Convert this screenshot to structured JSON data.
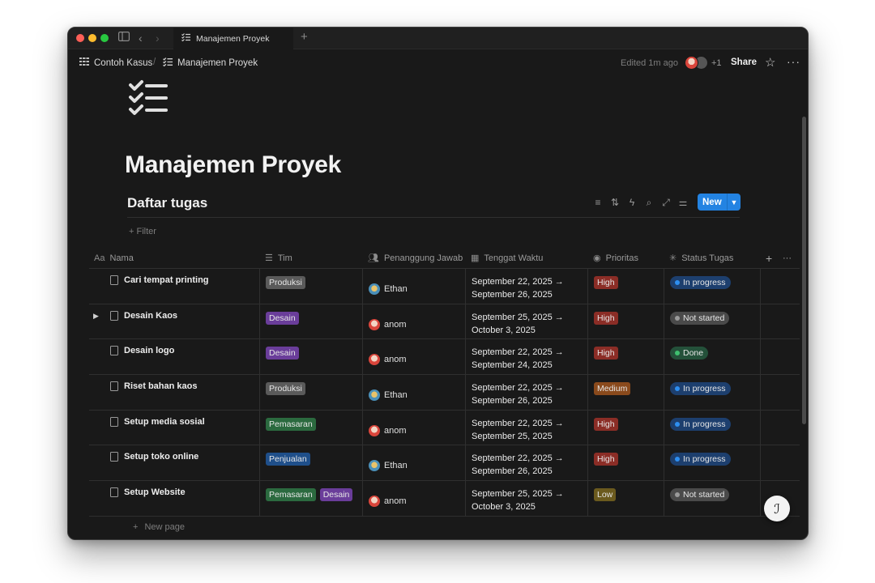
{
  "window": {
    "tab_title": "Manajemen Proyek"
  },
  "topbar": {
    "breadcrumb": [
      {
        "label": "Contoh Kasus",
        "icon": "table-icon"
      },
      {
        "label": "Manajemen Proyek",
        "icon": "checklist-icon"
      }
    ],
    "separator": "/",
    "edited": "Edited 1m ago",
    "extra_collaborators": "+1",
    "share_label": "Share"
  },
  "page": {
    "title": "Manajemen Proyek",
    "icon": "checklist-icon"
  },
  "database": {
    "title": "Daftar tugas",
    "new_label": "New",
    "filter_label": "Filter",
    "new_page_label": "New page",
    "columns": [
      {
        "label": "Nama",
        "icon": "Aa"
      },
      {
        "label": "Tim",
        "icon": "list-icon"
      },
      {
        "label": "Penanggung Jawab",
        "icon": "people-icon"
      },
      {
        "label": "Tenggat Waktu",
        "icon": "calendar-icon"
      },
      {
        "label": "Prioritas",
        "icon": "target-icon"
      },
      {
        "label": "Status Tugas",
        "icon": "loader-icon"
      }
    ],
    "rows": [
      {
        "name": "Cari tempat printing",
        "expandable": false,
        "tags": [
          {
            "label": "Produksi",
            "color": "#5a5a5a"
          }
        ],
        "person": "Ethan",
        "avatar": "ethan",
        "date_start": "September 22, 2025 →",
        "date_end": "September 26, 2025",
        "priority": "High",
        "status": "In progress"
      },
      {
        "name": "Desain Kaos",
        "expandable": true,
        "tags": [
          {
            "label": "Desain",
            "color": "#6a3d9a"
          }
        ],
        "person": "anom",
        "avatar": "anom",
        "date_start": "September 25, 2025 →",
        "date_end": "October 3, 2025",
        "priority": "High",
        "status": "Not started"
      },
      {
        "name": "Desain logo",
        "expandable": false,
        "tags": [
          {
            "label": "Desain",
            "color": "#6a3d9a"
          }
        ],
        "person": "anom",
        "avatar": "anom",
        "date_start": "September 22, 2025 →",
        "date_end": "September 24, 2025",
        "priority": "High",
        "status": "Done"
      },
      {
        "name": "Riset bahan kaos",
        "expandable": false,
        "tags": [
          {
            "label": "Produksi",
            "color": "#5a5a5a"
          }
        ],
        "person": "Ethan",
        "avatar": "ethan",
        "date_start": "September 22, 2025 →",
        "date_end": "September 26, 2025",
        "priority": "Medium",
        "status": "In progress"
      },
      {
        "name": "Setup media sosial",
        "expandable": false,
        "tags": [
          {
            "label": "Pemasaran",
            "color": "#2b6a3f"
          }
        ],
        "person": "anom",
        "avatar": "anom",
        "date_start": "September 22, 2025 →",
        "date_end": "September 25, 2025",
        "priority": "High",
        "status": "In progress"
      },
      {
        "name": "Setup toko online",
        "expandable": false,
        "tags": [
          {
            "label": "Penjualan",
            "color": "#1f4f8a"
          }
        ],
        "person": "Ethan",
        "avatar": "ethan",
        "date_start": "September 22, 2025 →",
        "date_end": "September 26, 2025",
        "priority": "High",
        "status": "In progress"
      },
      {
        "name": "Setup Website",
        "expandable": false,
        "tags": [
          {
            "label": "Pemasaran",
            "color": "#2b6a3f"
          },
          {
            "label": "Desain",
            "color": "#6a3d9a"
          }
        ],
        "person": "anom",
        "avatar": "anom",
        "date_start": "September 25, 2025 →",
        "date_end": "October 3, 2025",
        "priority": "Low",
        "status": "Not started"
      }
    ]
  },
  "colors": {
    "priority": {
      "High": "#8b2d26",
      "Medium": "#8a4a1c",
      "Low": "#6b5a1e"
    },
    "status": {
      "In progress": {
        "bg": "#1d3f6e",
        "dot": "#2e8ff0"
      },
      "Not started": {
        "bg": "#4a4a4a",
        "dot": "#9a9a9a"
      },
      "Done": {
        "bg": "#24513a",
        "dot": "#3fbf6f"
      }
    },
    "accent": "#2383e2"
  }
}
